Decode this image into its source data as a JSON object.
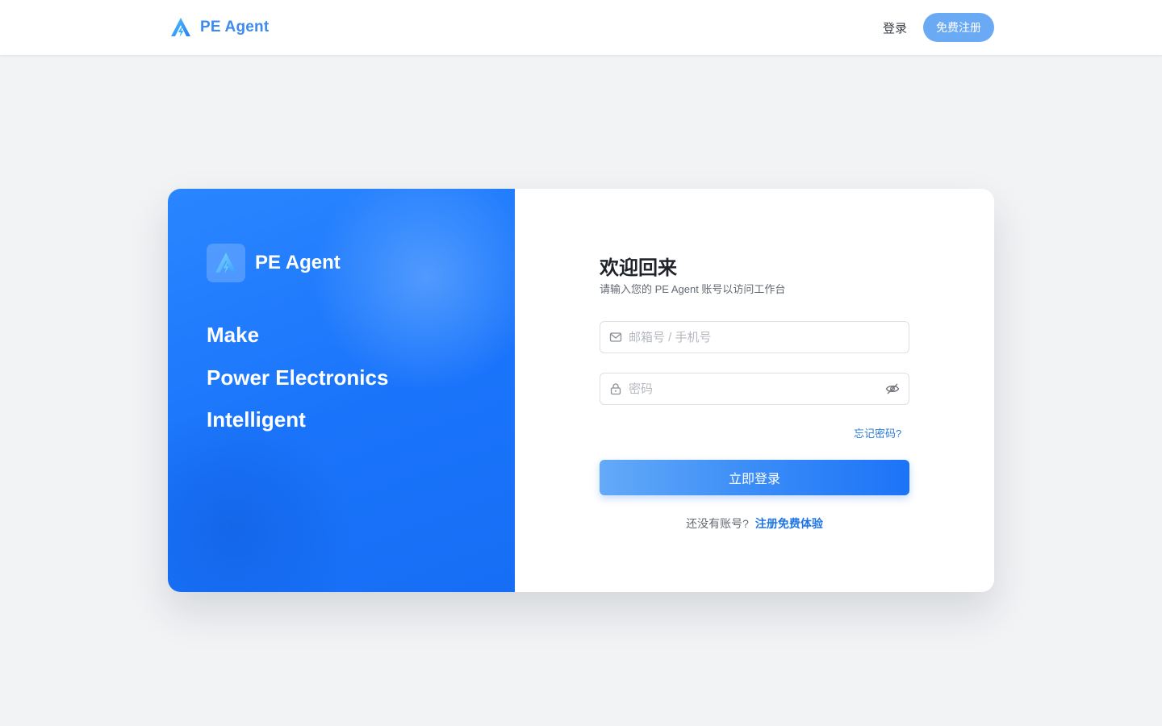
{
  "header": {
    "brand_name": "PE Agent",
    "login_label": "登录",
    "register_label": "免费注册"
  },
  "promo": {
    "brand_name": "PE Agent",
    "taglines": [
      "Make",
      "Power Electronics",
      "Intelligent"
    ]
  },
  "form": {
    "title": "欢迎回来",
    "subtitle": "请输入您的 PE Agent 账号以访问工作台",
    "email_placeholder": "邮箱号 / 手机号",
    "email_value": "",
    "password_placeholder": "密码",
    "password_value": "",
    "forgot_label": "忘记密码?",
    "submit_label": "立即登录",
    "signup_question": "还没有账号?",
    "signup_link": "注册免费体验"
  },
  "icons": {
    "logo": "pe-agent-logo-icon",
    "email": "mail-icon",
    "password": "lock-icon",
    "toggle_visibility": "eye-off-icon"
  },
  "colors": {
    "accent": "#1c73f7",
    "brand_text": "#3d8bef",
    "register_button": "#6aaaf4",
    "page_bg": "#f2f3f5",
    "link": "#1f75e6"
  }
}
